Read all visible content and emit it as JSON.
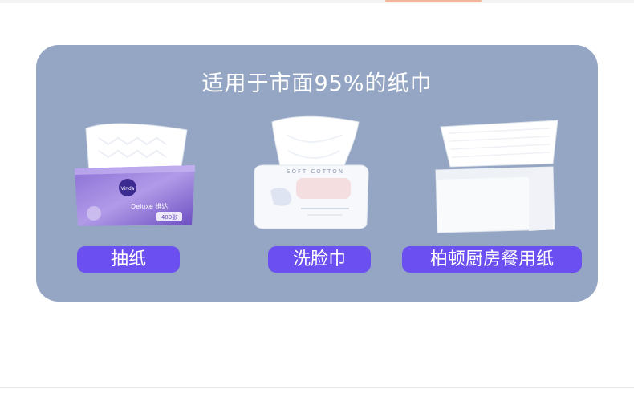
{
  "banner": {
    "title": "适用于市面95%的纸巾"
  },
  "products": [
    {
      "label": "抽纸",
      "icon": "tissue-box-icon"
    },
    {
      "label": "洗脸巾",
      "icon": "face-towel-pack-icon"
    },
    {
      "label": "柏顿厨房餐用纸",
      "icon": "kitchen-paper-pack-icon"
    }
  ],
  "product1_packaging": {
    "brand": "Vinda",
    "series": "Deluxe 维达",
    "count": "400张"
  },
  "product2_packaging": {
    "brand": "SOFT COTTON"
  },
  "colors": {
    "panel": "#94a6c3",
    "label_button": "#6b4ff0",
    "title_text": "#ffffff"
  }
}
